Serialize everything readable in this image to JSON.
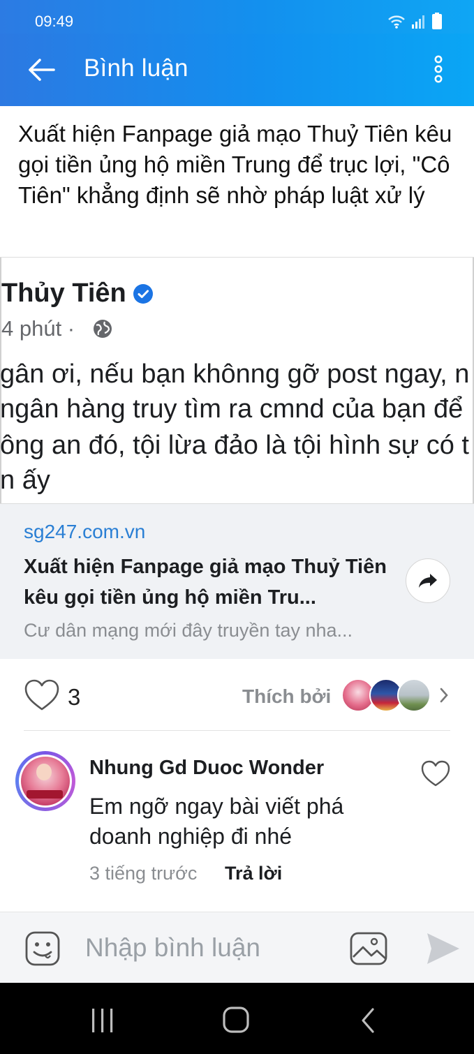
{
  "status_bar": {
    "time": "09:49"
  },
  "app_bar": {
    "title": "Bình luận"
  },
  "article": {
    "title": "Xuất hiện Fanpage giả mạo Thuỷ Tiên kêu gọi tiền ủng hộ miền Trung để trục lợi, \"Cô Tiên\" khẳng định sẽ nhờ pháp luật xử lý"
  },
  "post_image": {
    "author": "Thủy Tiên",
    "meta": "4 phút ·",
    "lines": [
      "gân ơi, nếu bạn khônng gỡ post ngay, n",
      "ngân hàng truy tìm ra cmnd của bạn để",
      "ông an đó, tội lừa đảo là tội hình sự có t",
      "n ấy"
    ]
  },
  "link_preview": {
    "domain": "sg247.com.vn",
    "title": "Xuất hiện Fanpage giả mạo Thuỷ Tiên kêu gọi tiền ủng hộ miền Tru...",
    "description": "Cư dân mạng mới đây truyền tay nha..."
  },
  "likes": {
    "count": "3",
    "liked_by_label": "Thích bởi"
  },
  "comments": [
    {
      "author": "Nhung Gd Duoc Wonder",
      "text": "Em ngỡ ngay bài viết phá doanh nghiệp đi nhé",
      "time": "3 tiếng trước",
      "reply_label": "Trả lời"
    }
  ],
  "composer": {
    "placeholder": "Nhập bình luận"
  },
  "colors": {
    "app_bar_start": "#2c79e2",
    "app_bar_end": "#0aa6f5",
    "link": "#2a7fd4",
    "verified": "#1b74e4"
  },
  "icons": [
    "back-arrow-icon",
    "more-vertical-icon",
    "globe-icon",
    "share-arrow-icon",
    "heart-icon",
    "chevron-right-icon",
    "emoji-icon",
    "image-icon",
    "send-icon",
    "wifi-icon",
    "signal-icon",
    "battery-icon"
  ]
}
